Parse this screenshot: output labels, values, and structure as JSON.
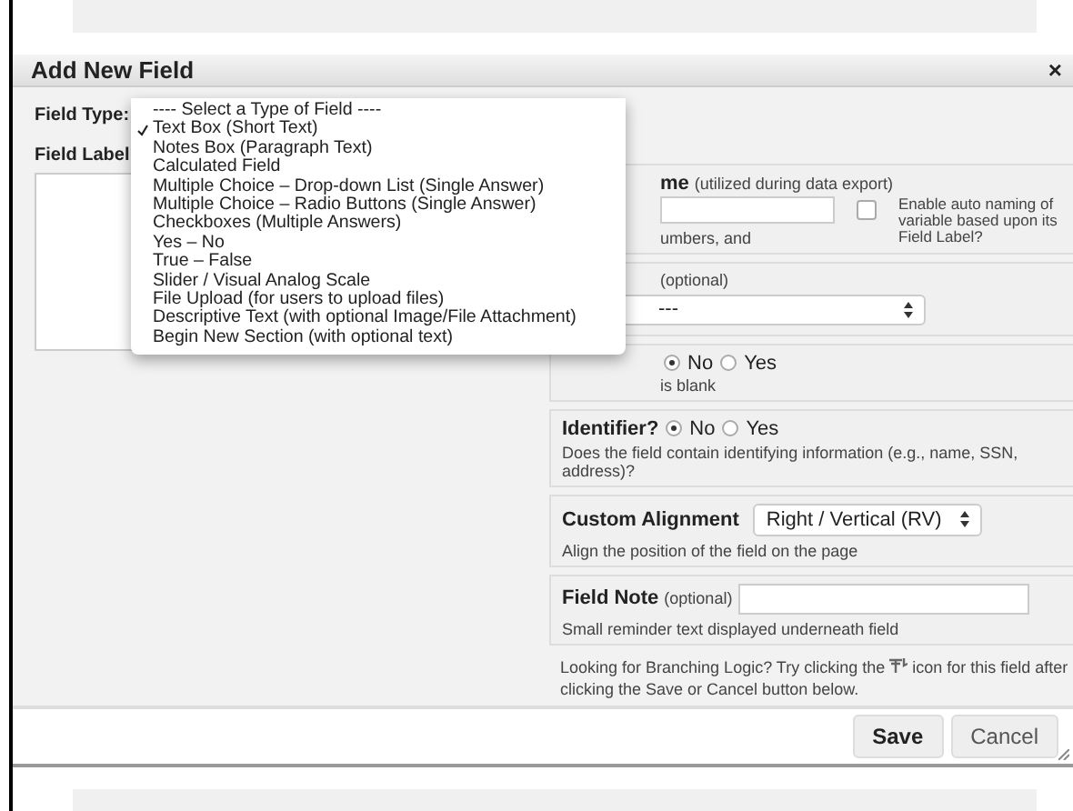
{
  "dialog": {
    "title": "Add New Field",
    "close": "×"
  },
  "field_type": {
    "label": "Field Type:"
  },
  "field_label": {
    "label": "Field Label"
  },
  "type_menu": [
    {
      "label": "---- Select a Type of Field ----",
      "selected": false
    },
    {
      "label": "Text Box (Short Text)",
      "selected": true
    },
    {
      "label": "Notes Box (Paragraph Text)",
      "selected": false
    },
    {
      "label": "Calculated Field",
      "selected": false
    },
    {
      "label": "Multiple Choice – Drop-down List (Single Answer)",
      "selected": false
    },
    {
      "label": "Multiple Choice – Radio Buttons (Single Answer)",
      "selected": false
    },
    {
      "label": "Checkboxes (Multiple Answers)",
      "selected": false
    },
    {
      "label": "Yes – No",
      "selected": false
    },
    {
      "label": "True – False",
      "selected": false
    },
    {
      "label": "Slider / Visual Analog Scale",
      "selected": false
    },
    {
      "label": "File Upload (for users to upload files)",
      "selected": false
    },
    {
      "label": "Descriptive Text (with optional Image/File Attachment)",
      "selected": false
    },
    {
      "label": "Begin New Section (with optional text)",
      "selected": false
    }
  ],
  "variable_name": {
    "label": "me",
    "note": "(utilized during data export)",
    "hint": "umbers, and",
    "auto_naming": {
      "label": "Enable auto naming of variable based upon its Field Label?",
      "checked": false
    }
  },
  "validation": {
    "note": "(optional)",
    "value": "---"
  },
  "required": {
    "options": [
      {
        "label": "No",
        "selected": true
      },
      {
        "label": "Yes",
        "selected": false
      }
    ],
    "hint": "is blank"
  },
  "identifier": {
    "label": "Identifier?",
    "options": [
      {
        "label": "No",
        "selected": true
      },
      {
        "label": "Yes",
        "selected": false
      }
    ],
    "hint": "Does the field contain identifying information (e.g., name, SSN, address)?"
  },
  "custom_alignment": {
    "label": "Custom Alignment",
    "value": "Right / Vertical (RV)",
    "hint": "Align the position of the field on the page"
  },
  "field_note": {
    "label": "Field Note",
    "note": "(optional)",
    "hint": "Small reminder text displayed underneath field"
  },
  "branching_note": {
    "before": "Looking for Branching Logic? Try clicking the",
    "after": "icon for this field after",
    "continuation": "clicking the Save or Cancel button below."
  },
  "buttons": [
    {
      "label": "Save",
      "kind": "primary"
    },
    {
      "label": "Cancel",
      "kind": "secondary"
    }
  ]
}
